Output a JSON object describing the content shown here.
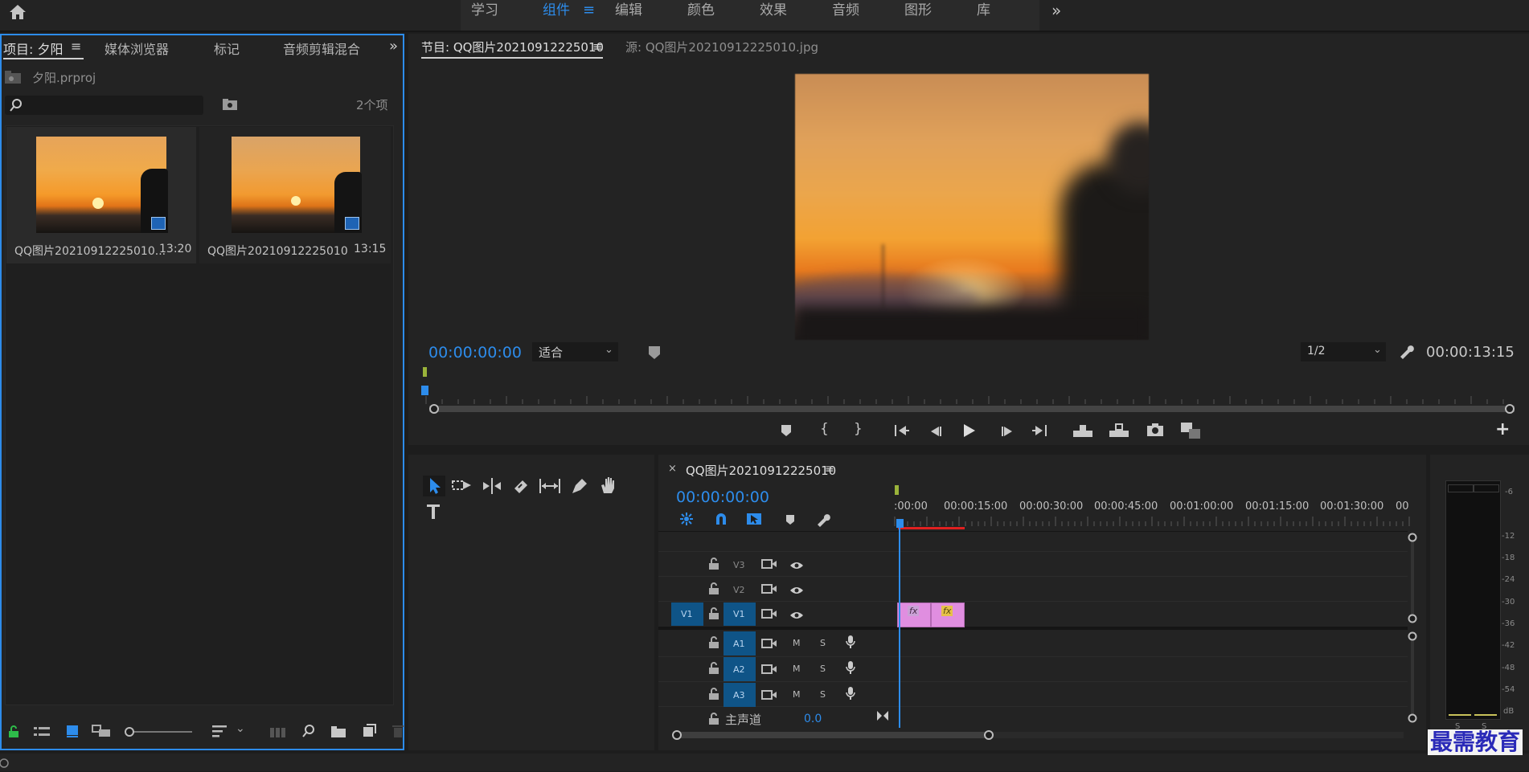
{
  "colors": {
    "accent": "#2d8ceb",
    "clip_pink": "#e08ee0",
    "playhead": "#2d8ceb",
    "render_bar": "#e02020"
  },
  "workspaces": {
    "items": [
      {
        "label": "学习"
      },
      {
        "label": "组件"
      },
      {
        "label": "编辑"
      },
      {
        "label": "颜色"
      },
      {
        "label": "效果"
      },
      {
        "label": "音频"
      },
      {
        "label": "图形"
      },
      {
        "label": "库"
      }
    ],
    "menu_glyph": "≡",
    "more_glyph": "»"
  },
  "project_panel": {
    "tabs": [
      {
        "label": "项目: 夕阳"
      },
      {
        "label": "媒体浏览器"
      },
      {
        "label": "标记"
      },
      {
        "label": "音频剪辑混合"
      }
    ],
    "project_file": "夕阳.prproj",
    "item_count": "2个项",
    "items": [
      {
        "name": "QQ图片20210912225010...",
        "duration": "13:20"
      },
      {
        "name": "QQ图片20210912225010",
        "duration": "13:15"
      }
    ]
  },
  "program_monitor": {
    "tab_program": "节目: QQ图片20210912225010",
    "tab_source": "源: QQ图片20210912225010.jpg",
    "timecode_current": "00:00:00:00",
    "fit_option": "适合",
    "resolution": "1/2",
    "timecode_duration": "00:00:13:15"
  },
  "timeline": {
    "sequence_name": "QQ图片20210912225010",
    "timecode": "00:00:00:00",
    "ruler_labels": [
      ":00:00",
      "00:00:15:00",
      "00:00:30:00",
      "00:00:45:00",
      "00:01:00:00",
      "00:01:15:00",
      "00:01:30:00",
      "00"
    ],
    "video_tracks": [
      {
        "name": "V3"
      },
      {
        "name": "V2"
      },
      {
        "name": "V1",
        "source": "V1"
      }
    ],
    "audio_tracks": [
      {
        "name": "A1",
        "m": "M",
        "s": "S"
      },
      {
        "name": "A2",
        "m": "M",
        "s": "S"
      },
      {
        "name": "A3",
        "m": "M",
        "s": "S"
      }
    ],
    "master_label": "主声道",
    "master_value": "0.0",
    "clip_fx": "fx"
  },
  "audio_meter": {
    "scale": [
      "-6",
      "-12",
      "-18",
      "-24",
      "-30",
      "-36",
      "-42",
      "-48",
      "-54",
      "dB"
    ],
    "solo_labels": [
      "S",
      "S"
    ]
  },
  "watermark": "最需教育"
}
